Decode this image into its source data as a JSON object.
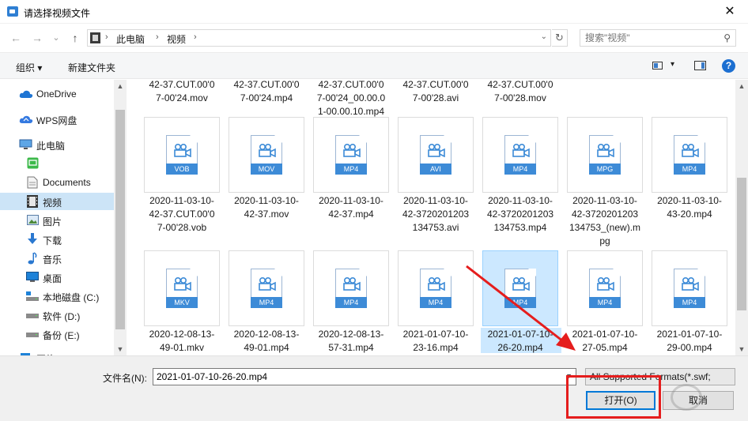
{
  "window": {
    "title": "请选择视频文件",
    "close_label": "✕"
  },
  "nav": {
    "back": "←",
    "forward": "→",
    "recent": "⌄",
    "up": "↑"
  },
  "address": {
    "crumbs": [
      "此电脑",
      "视频"
    ],
    "refresh": "↻"
  },
  "search": {
    "placeholder": "搜索\"视频\""
  },
  "toolbar": {
    "organize_label": "组织 ▾",
    "new_folder_label": "新建文件夹"
  },
  "sidebar": {
    "items": [
      {
        "label": "OneDrive",
        "icon": "cloud-icon"
      },
      {
        "label": "WPS网盘",
        "icon": "wps-cloud-icon"
      },
      {
        "label": "此电脑",
        "icon": "computer-icon"
      },
      {
        "label": "",
        "icon": "green-app-icon"
      },
      {
        "label": "Documents",
        "icon": "documents-icon"
      },
      {
        "label": "视频",
        "icon": "video-folder-icon",
        "selected": true
      },
      {
        "label": "图片",
        "icon": "pictures-icon"
      },
      {
        "label": "下载",
        "icon": "downloads-icon"
      },
      {
        "label": "音乐",
        "icon": "music-icon"
      },
      {
        "label": "桌面",
        "icon": "desktop-icon"
      },
      {
        "label": "本地磁盘 (C:)",
        "icon": "drive-c-icon"
      },
      {
        "label": "软件 (D:)",
        "icon": "drive-d-icon"
      },
      {
        "label": "备份 (E:)",
        "icon": "drive-e-icon"
      },
      {
        "label": "网络",
        "icon": "network-icon"
      }
    ]
  },
  "files": {
    "partial_row": [
      "42-37.CUT.00'0\n7-00'24.mov",
      "42-37.CUT.00'0\n7-00'24.mp4",
      "42-37.CUT.00'0\n7-00'24_00.00.0\n1-00.00.10.mp4",
      "42-37.CUT.00'0\n7-00'28.avi",
      "42-37.CUT.00'0\n7-00'28.mov"
    ],
    "row1": [
      {
        "name": "2020-11-03-10-\n42-37.CUT.00'0\n7-00'28.vob",
        "badge": "VOB"
      },
      {
        "name": "2020-11-03-10-\n42-37.mov",
        "badge": "MOV"
      },
      {
        "name": "2020-11-03-10-\n42-37.mp4",
        "badge": "MP4"
      },
      {
        "name": "2020-11-03-10-\n42-3720201203\n134753.avi",
        "badge": "AVI"
      },
      {
        "name": "2020-11-03-10-\n42-3720201203\n134753.mp4",
        "badge": "MP4"
      },
      {
        "name": "2020-11-03-10-\n42-3720201203\n134753_(new).m\npg",
        "badge": "MPG"
      },
      {
        "name": "2020-11-03-10-\n43-20.mp4",
        "badge": "MP4"
      }
    ],
    "row2": [
      {
        "name": "2020-12-08-13-\n49-01.mkv",
        "badge": "MKV"
      },
      {
        "name": "2020-12-08-13-\n49-01.mp4",
        "badge": "MP4"
      },
      {
        "name": "2020-12-08-13-\n57-31.mp4",
        "badge": "MP4"
      },
      {
        "name": "2021-01-07-10-\n23-16.mp4",
        "badge": "MP4"
      },
      {
        "name": "2021-01-07-10-\n26-20.mp4",
        "badge": "MP4",
        "selected": true
      },
      {
        "name": "2021-01-07-10-\n27-05.mp4",
        "badge": "MP4"
      },
      {
        "name": "2021-01-07-10-\n29-00.mp4",
        "badge": "MP4"
      }
    ]
  },
  "footer": {
    "filename_label": "文件名(N):",
    "filename_value": "2021-01-07-10-26-20.mp4",
    "filter_value": "All Supported Formats(*.swf;",
    "open_label": "打开(O)",
    "cancel_label": "取消"
  },
  "colors": {
    "accent": "#0078d7",
    "annotation": "#e51d1d",
    "badge": "#3d8bd7",
    "selection": "#cce8ff"
  }
}
